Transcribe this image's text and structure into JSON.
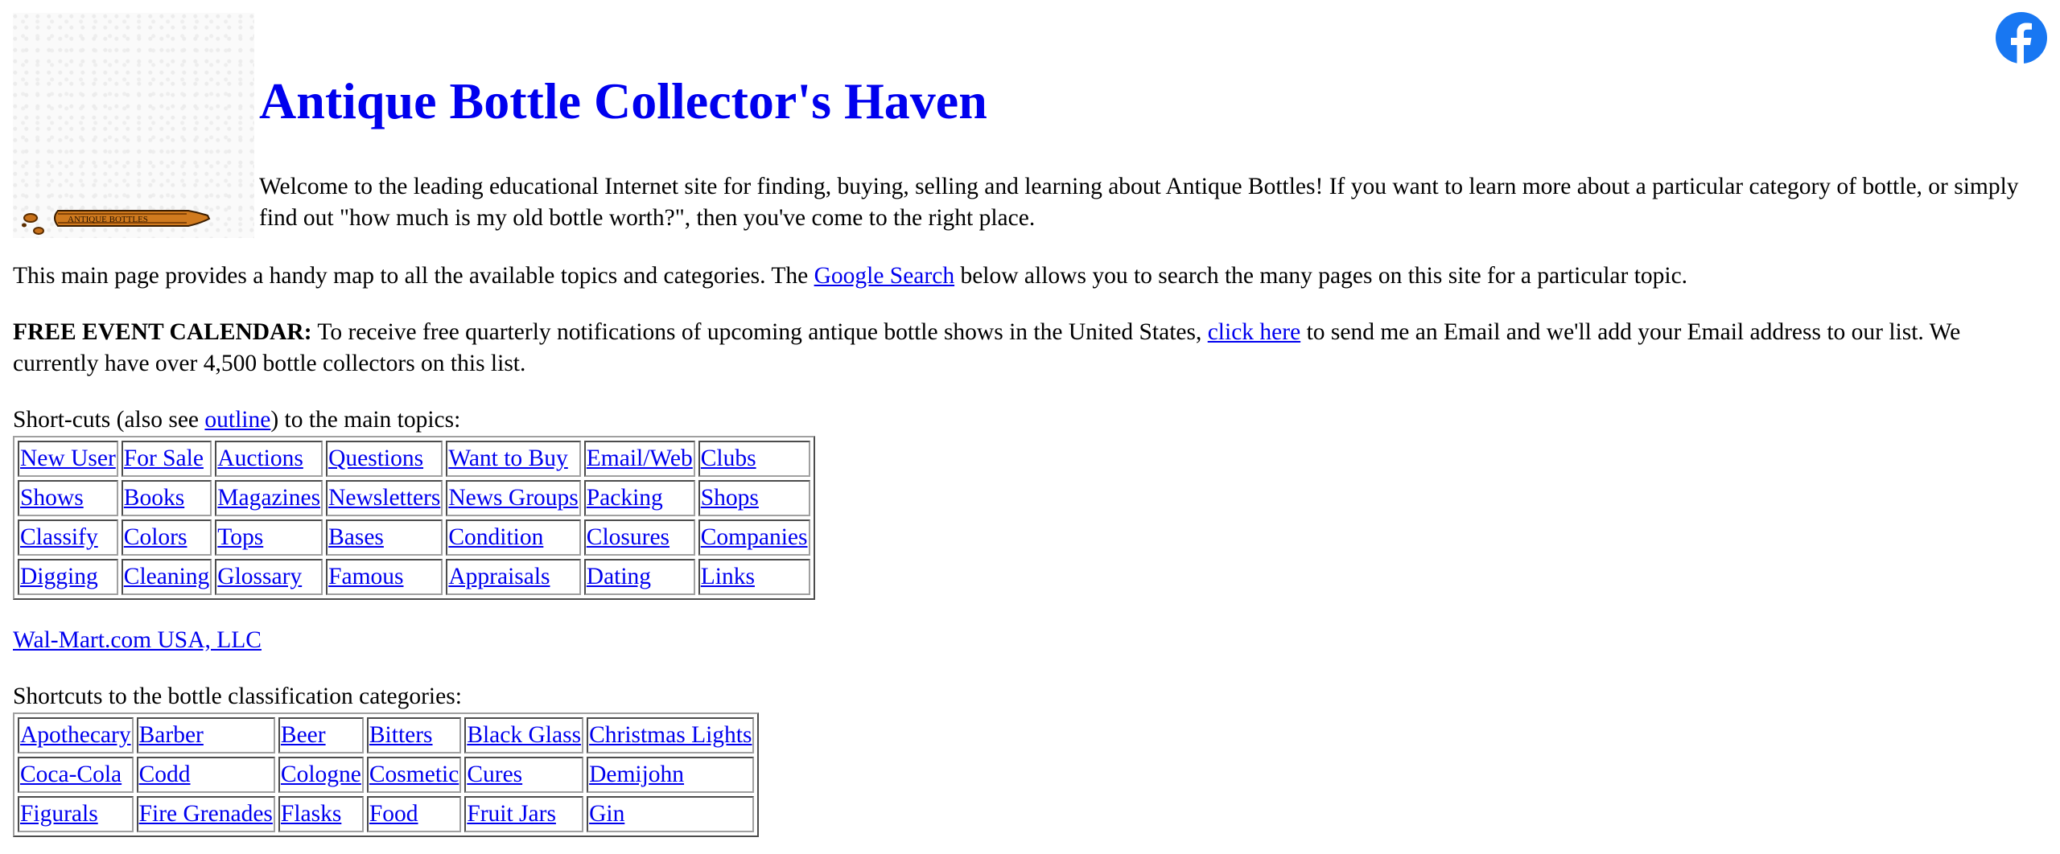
{
  "header": {
    "title": "Antique Bottle Collector's Haven",
    "intro": "Welcome to the leading educational Internet site for finding, buying, selling and learning about Antique Bottles! If you want to learn more about a particular category of bottle, or simply find out \"how much is my old bottle worth?\", then you've come to the right place.",
    "logo_text": "ANTIQUE BOTTLES",
    "facebook_icon": "facebook-icon"
  },
  "main_map": {
    "before": "This main page provides a handy map to all the available topics and categories. The ",
    "link": "Google Search",
    "after": " below allows you to search the many pages on this site for a particular topic."
  },
  "event_calendar": {
    "label": "FREE EVENT CALENDAR:",
    "before": " To receive free quarterly notifications of upcoming antique bottle shows in the United States, ",
    "link": "click here",
    "after": " to send me an Email and we'll add your Email address to our list. We currently have over 4,500 bottle collectors on this list."
  },
  "shortcuts": {
    "before": "Short-cuts (also see ",
    "link": "outline",
    "after": ") to the main topics:",
    "rows": [
      [
        "New User",
        "For Sale",
        "Auctions",
        "Questions",
        "Want to Buy",
        "Email/Web",
        "Clubs"
      ],
      [
        "Shows",
        "Books",
        "Magazines",
        "Newsletters",
        "News Groups",
        "Packing",
        "Shops"
      ],
      [
        "Classify",
        "Colors",
        "Tops",
        "Bases",
        "Condition",
        "Closures",
        "Companies"
      ],
      [
        "Digging",
        "Cleaning",
        "Glossary",
        "Famous",
        "Appraisals",
        "Dating",
        "Links"
      ]
    ]
  },
  "sponsor": {
    "link": "Wal-Mart.com USA, LLC"
  },
  "classification": {
    "heading": "Shortcuts to the bottle classification categories:",
    "rows": [
      [
        "Apothecary",
        "Barber",
        "Beer",
        "Bitters",
        "Black Glass",
        "Christmas Lights"
      ],
      [
        "Coca-Cola",
        "Codd",
        "Cologne",
        "Cosmetic",
        "Cures",
        "Demijohn"
      ],
      [
        "Figurals",
        "Fire Grenades",
        "Flasks",
        "Food",
        "Fruit Jars",
        "Gin"
      ]
    ]
  },
  "colors": {
    "link": "#0000ee",
    "title": "#0000ee",
    "facebook": "#1877f2",
    "bottle": "#c8711a"
  }
}
